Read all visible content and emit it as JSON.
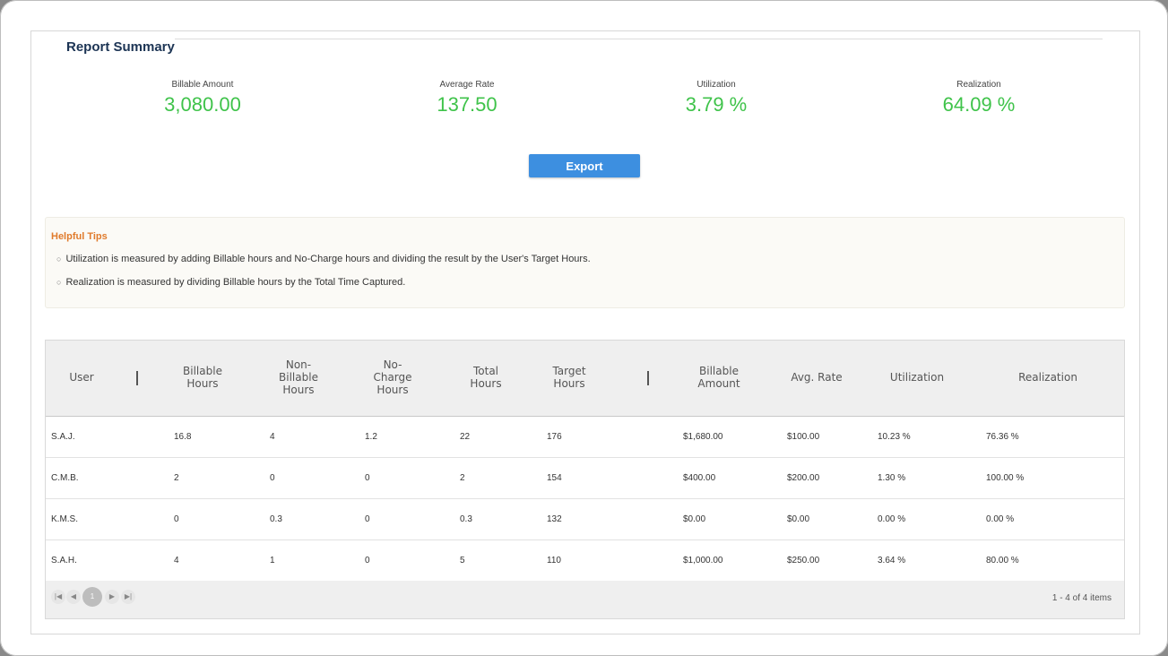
{
  "summary": {
    "title": "Report Summary",
    "metrics": [
      {
        "label": "Billable Amount",
        "value": "3,080.00"
      },
      {
        "label": "Average Rate",
        "value": "137.50"
      },
      {
        "label": "Utilization",
        "value": "3.79 %"
      },
      {
        "label": "Realization",
        "value": "64.09 %"
      }
    ],
    "export_label": "Export",
    "value_color": "#3fc34a",
    "button_color": "#3d8fe0"
  },
  "tips": {
    "title": "Helpful Tips",
    "items": [
      "Utilization is measured by adding Billable hours and No-Charge hours and dividing the result by the User's Target Hours.",
      "Realization is measured by dividing Billable hours by the Total Time Captured."
    ],
    "bullet_icon": "circle-bullet-icon"
  },
  "table": {
    "columns": [
      "User",
      "Billable\nHours",
      "Non-\nBillable\nHours",
      "No-\nCharge\nHours",
      "Total\nHours",
      "Target\nHours",
      "Billable\nAmount",
      "Avg. Rate",
      "Utilization",
      "Realization"
    ],
    "rows": [
      [
        "S.A.J.",
        "16.8",
        "4",
        "1.2",
        "22",
        "176",
        "$1,680.00",
        "$100.00",
        "10.23 %",
        "76.36 %"
      ],
      [
        "C.M.B.",
        "2",
        "0",
        "0",
        "2",
        "154",
        "$400.00",
        "$200.00",
        "1.30 %",
        "100.00 %"
      ],
      [
        "K.M.S.",
        "0",
        "0.3",
        "0",
        "0.3",
        "132",
        "$0.00",
        "$0.00",
        "0.00 %",
        "0.00 %"
      ],
      [
        "S.A.H.",
        "4",
        "1",
        "0",
        "5",
        "110",
        "$1,000.00",
        "$250.00",
        "3.64 %",
        "80.00 %"
      ]
    ]
  },
  "pager": {
    "first_icon": "first-page-icon",
    "prev_icon": "prev-page-icon",
    "current_page": "1",
    "next_icon": "next-page-icon",
    "last_icon": "last-page-icon",
    "info": "1 - 4 of 4 items"
  }
}
